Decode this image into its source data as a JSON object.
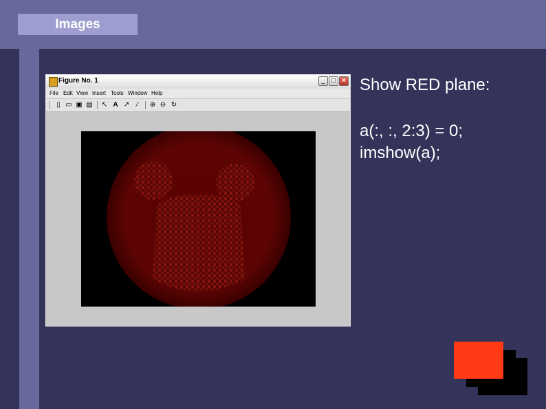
{
  "slide": {
    "title_tab": "Images",
    "text_line1": "Show RED plane:",
    "code_line1": "a(:, :, 2:3) = 0;",
    "code_line2": "imshow(a);"
  },
  "figure_window": {
    "title": "Figure No. 1",
    "controls": {
      "minimize": "_",
      "maximize": "□",
      "close": "×"
    },
    "menu": [
      "File",
      "Edit",
      "View",
      "Insert",
      "Tools",
      "Window",
      "Help"
    ],
    "toolbar_icons": [
      "new-file-icon",
      "open-folder-icon",
      "save-icon",
      "print-icon",
      "pointer-icon",
      "text-icon",
      "arrow-icon",
      "line-icon",
      "zoom-in-icon",
      "zoom-out-icon",
      "rotate-icon"
    ]
  },
  "colors": {
    "background": "#34345a",
    "band": "#68689c",
    "tab": "#9d9dd0",
    "accent_red": "#ff3a14"
  }
}
